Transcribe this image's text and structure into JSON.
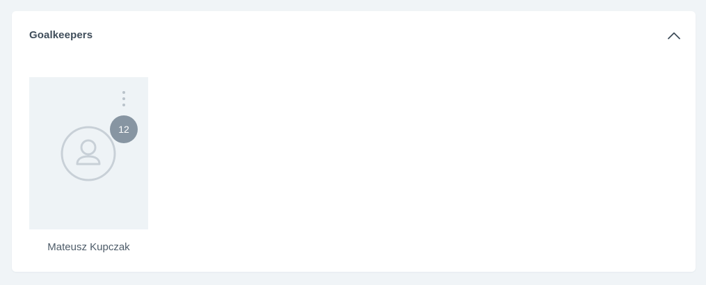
{
  "section": {
    "title": "Goalkeepers",
    "collapse_icon": "chevron-up-icon"
  },
  "players": [
    {
      "name": "Mateusz Kupczak",
      "number": "12",
      "avatar_icon": "user-placeholder-icon",
      "menu_icon": "more-vertical-icon"
    }
  ],
  "colors": {
    "page_background": "#f0f4f7",
    "card_background": "#eef3f6",
    "badge_background": "#8795a2",
    "title_text": "#3f4d5a",
    "name_text": "#4e5c69"
  }
}
